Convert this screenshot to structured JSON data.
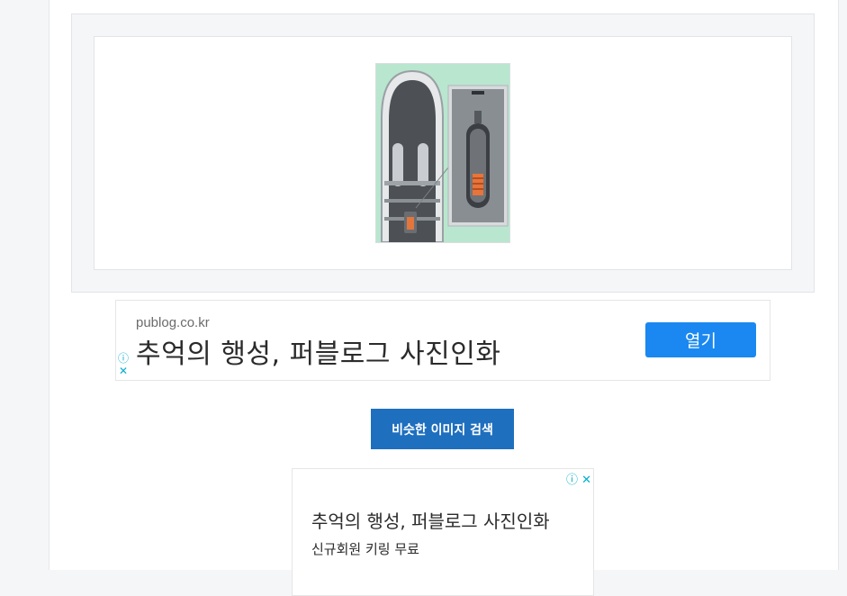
{
  "image_result": {
    "thumbnail_icon": "reactor-vessel-image"
  },
  "ad_banner": {
    "domain": "publog.co.kr",
    "headline": "추억의 행성, 퍼블로그 사진인화",
    "open_label": "열기",
    "info_icon": "info-icon",
    "close_icon": "close-icon",
    "accent_color": "#1a88f0"
  },
  "similar_search": {
    "label": "비슷한 이미지 검색",
    "color": "#1f6fbf"
  },
  "ad_box": {
    "title": "추억의 행성, 퍼블로그 사진인화",
    "subtitle": "신규회원 키링 무료",
    "info_icon": "info-icon",
    "close_icon": "close-icon"
  }
}
